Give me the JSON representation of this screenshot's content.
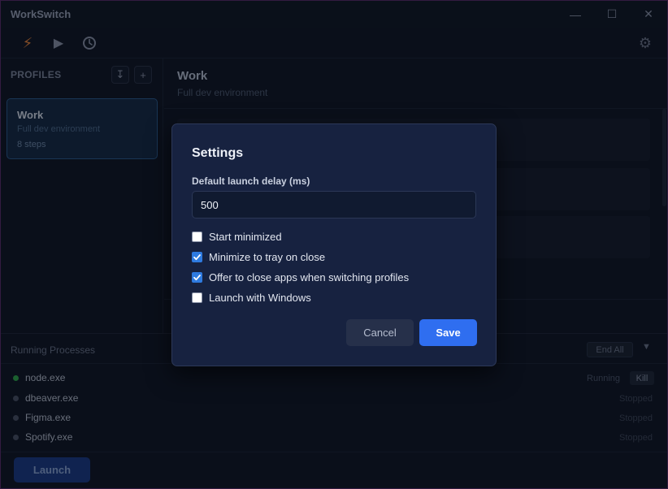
{
  "app": {
    "title": "WorkSwitch",
    "window_controls": {
      "minimize": "—",
      "maximize": "☐",
      "close": "✕"
    }
  },
  "toolbar": {
    "icons": [
      "bolt-icon",
      "play-icon",
      "history-icon",
      "gear-icon"
    ],
    "bolt_glyph": "⚡",
    "play_glyph": "▶",
    "gear_glyph": "⚙"
  },
  "sidebar": {
    "title": "PROFILES",
    "import_glyph": "↧",
    "add_glyph": "+",
    "profiles": [
      {
        "name": "Work",
        "description": "Full dev environment",
        "steps": "8 steps"
      }
    ]
  },
  "main": {
    "title": "Work",
    "description": "Full dev environment"
  },
  "processes": {
    "title": "Running Processes",
    "end_all_label": "End All",
    "collapse_glyph": "▼",
    "items": [
      {
        "name": "node.exe",
        "status": "Running",
        "kill_label": "Kill",
        "running": true
      },
      {
        "name": "dbeaver.exe",
        "status": "Stopped",
        "running": false
      },
      {
        "name": "Figma.exe",
        "status": "Stopped",
        "running": false
      },
      {
        "name": "Spotify.exe",
        "status": "Stopped",
        "running": false
      }
    ]
  },
  "bottombar": {
    "launch_label": "Launch"
  },
  "dialog": {
    "title": "Settings",
    "delay_label": "Default launch delay (ms)",
    "delay_value": "500",
    "options": [
      {
        "label": "Start minimized",
        "checked": false
      },
      {
        "label": "Minimize to tray on close",
        "checked": true
      },
      {
        "label": "Offer to close apps when switching profiles",
        "checked": true
      },
      {
        "label": "Launch with Windows",
        "checked": false
      }
    ],
    "cancel_label": "Cancel",
    "save_label": "Save"
  },
  "colors": {
    "accent": "#2f6ef0",
    "running": "#2fa84a",
    "bolt": "#e8843a"
  }
}
